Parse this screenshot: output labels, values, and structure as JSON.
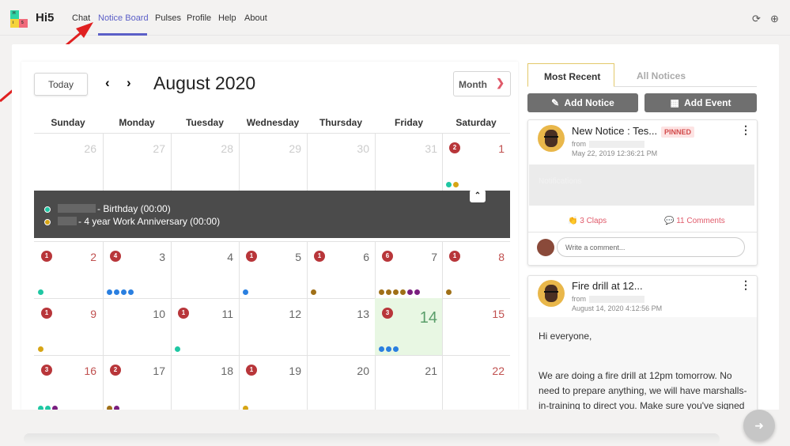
{
  "app": {
    "name": "Hi5",
    "logo_letters": [
      "H",
      "i",
      "5"
    ]
  },
  "nav": {
    "items": [
      "Chat",
      "Notice Board",
      "Pulses",
      "Profile",
      "Help",
      "About"
    ],
    "active": "Notice Board"
  },
  "calendar": {
    "today_label": "Today",
    "prev_icon": "‹",
    "next_icon": "›",
    "title": "August 2020",
    "view": "Month",
    "weekdays": [
      "Sunday",
      "Monday",
      "Tuesday",
      "Wednesday",
      "Thursday",
      "Friday",
      "Saturday"
    ],
    "rows": [
      [
        {
          "d": "26",
          "muted": true
        },
        {
          "d": "27",
          "muted": true
        },
        {
          "d": "28",
          "muted": true
        },
        {
          "d": "29",
          "muted": true
        },
        {
          "d": "30",
          "muted": true
        },
        {
          "d": "31",
          "muted": true
        },
        {
          "d": "1",
          "badge": "2",
          "dots": [
            "#1fc7a3",
            "#d7a515"
          ],
          "weekend": true
        }
      ],
      [
        {
          "d": "2",
          "badge": "1",
          "dots": [
            "#1fc7a3"
          ],
          "weekend": true
        },
        {
          "d": "3",
          "badge": "4",
          "dots": [
            "#2a7fe0",
            "#2a7fe0",
            "#2a7fe0",
            "#2a7fe0"
          ]
        },
        {
          "d": "4"
        },
        {
          "d": "5",
          "badge": "1",
          "dots": [
            "#2a7fe0"
          ]
        },
        {
          "d": "6",
          "badge": "1",
          "dots": [
            "#a07018"
          ]
        },
        {
          "d": "7",
          "badge": "6",
          "dots": [
            "#a07018",
            "#a07018",
            "#a07018",
            "#a07018",
            "#7a1f7f",
            "#7a1f7f"
          ]
        },
        {
          "d": "8",
          "badge": "1",
          "dots": [
            "#a07018"
          ],
          "weekend": true
        }
      ],
      [
        {
          "d": "9",
          "badge": "1",
          "dots": [
            "#d7a515"
          ],
          "weekend": true
        },
        {
          "d": "10"
        },
        {
          "d": "11",
          "badge": "1",
          "dots": [
            "#1fc7a3"
          ]
        },
        {
          "d": "12"
        },
        {
          "d": "13"
        },
        {
          "d": "14",
          "badge": "3",
          "dots": [
            "#2a7fe0",
            "#2a7fe0",
            "#2a7fe0"
          ],
          "today": true
        },
        {
          "d": "15",
          "weekend": true
        }
      ],
      [
        {
          "d": "16",
          "badge": "3",
          "dots": [
            "#1fc7a3",
            "#1fc7a3",
            "#7a1f7f"
          ],
          "weekend": true
        },
        {
          "d": "17",
          "badge": "2",
          "dots": [
            "#a07018",
            "#7a1f7f"
          ]
        },
        {
          "d": "18"
        },
        {
          "d": "19",
          "badge": "1",
          "dots": [
            "#d7a515"
          ]
        },
        {
          "d": "20"
        },
        {
          "d": "21"
        },
        {
          "d": "22",
          "weekend": true
        }
      ]
    ],
    "popup": {
      "events": [
        {
          "text": "- Birthday (00:00)",
          "color": "#1fc7a3"
        },
        {
          "text": "- 4 year Work Anniversary (00:00)",
          "color": "#d7a515"
        }
      ],
      "collapse_icon": "⌃"
    }
  },
  "notices": {
    "tabs": [
      "Most Recent",
      "All Notices"
    ],
    "add_notice": "Add Notice",
    "add_event": "Add Event",
    "cards": [
      {
        "title": "New Notice : Tes...",
        "pinned": "PINNED",
        "from": "from",
        "date": "May 22, 2019 12:36:21 PM",
        "body": "Notifications",
        "claps": "3 Claps",
        "comments": "11 Comments",
        "comment_placeholder": "Write a comment..."
      },
      {
        "title": "Fire drill at 12...",
        "from": "from",
        "date": "August 14, 2020 4:12:56 PM",
        "greeting": "Hi everyone,",
        "body": "We are doing a fire drill at 12pm tomorrow. No need to prepare anything, we will have marshalls-in-training to direct you. Make sure you've signed"
      }
    ]
  },
  "colors": {
    "accent": "#5b5fc7",
    "weekend": "#c0504f",
    "today_bg": "#e8f7e3",
    "badge": "#b8363a"
  }
}
